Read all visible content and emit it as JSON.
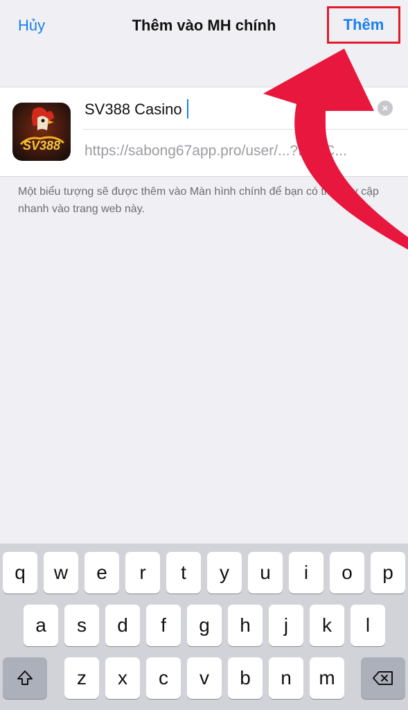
{
  "nav": {
    "cancel": "Hủy",
    "title": "Thêm vào MH chính",
    "add": "Thêm"
  },
  "form": {
    "name_value": "SV388 Casino",
    "url": "https://sabong67app.pro/user/...?Pu=C...",
    "app_icon_text": "SV388"
  },
  "hint": "Một biểu tượng sẽ được thêm vào Màn hình chính để bạn có thể truy cập nhanh vào trang web này.",
  "keyboard": {
    "row1": [
      "q",
      "w",
      "e",
      "r",
      "t",
      "y",
      "u",
      "i",
      "o",
      "p"
    ],
    "row2": [
      "a",
      "s",
      "d",
      "f",
      "g",
      "h",
      "j",
      "k",
      "l"
    ],
    "row3": [
      "z",
      "x",
      "c",
      "v",
      "b",
      "n",
      "m"
    ]
  },
  "colors": {
    "accent": "#1a7ff0",
    "highlight_box": "#e21b2c",
    "arrow": "#e8173d"
  }
}
